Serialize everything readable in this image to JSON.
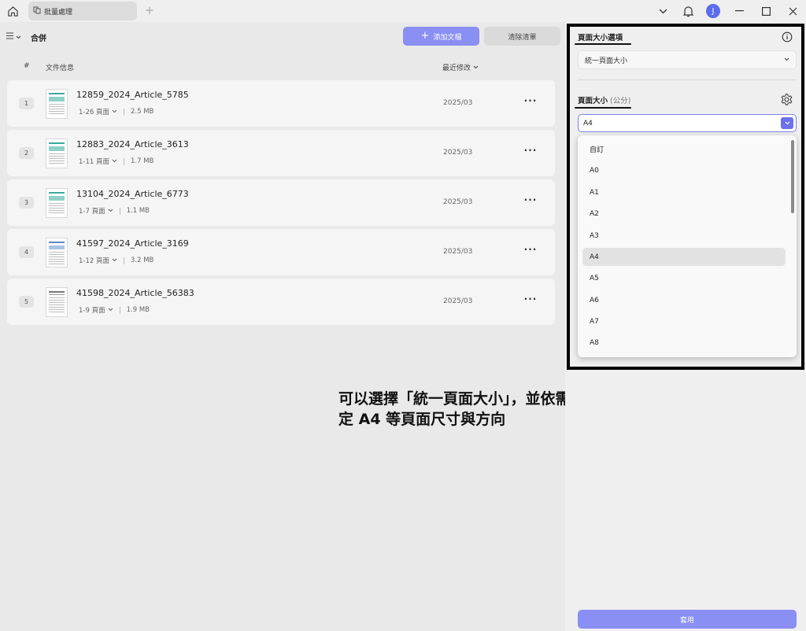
{
  "titlebar": {
    "tab_label": "批量處理",
    "avatar_letter": "J"
  },
  "toolbar": {
    "title": "合併",
    "add_label": "添加文檔",
    "clear_label": "清除清單"
  },
  "table": {
    "col_number": "#",
    "col_info": "文件信息",
    "col_modified": "最近修改"
  },
  "files": [
    {
      "number": "1",
      "name": "12859_2024_Article_5785",
      "pages": "1-26 頁面",
      "size": "2.5 MB",
      "date": "2025/03"
    },
    {
      "number": "2",
      "name": "12883_2024_Article_3613",
      "pages": "1-11 頁面",
      "size": "1.7 MB",
      "date": "2025/03"
    },
    {
      "number": "3",
      "name": "13104_2024_Article_6773",
      "pages": "1-7 頁面",
      "size": "1.1 MB",
      "date": "2025/03"
    },
    {
      "number": "4",
      "name": "41597_2024_Article_3169",
      "pages": "1-12 頁面",
      "size": "3.2 MB",
      "date": "2025/03"
    },
    {
      "number": "5",
      "name": "41598_2024_Article_56383",
      "pages": "1-9 頁面",
      "size": "1.9 MB",
      "date": "2025/03"
    }
  ],
  "panel": {
    "page_size_options_title": "頁面大小選項",
    "page_size_mode": "統一頁面大小",
    "page_size_title": "頁面大小",
    "page_size_unit": "(公分)",
    "page_size_value": "A4",
    "dropdown_options": [
      "自訂",
      "A0",
      "A1",
      "A2",
      "A3",
      "A4",
      "A5",
      "A6",
      "A7",
      "A8"
    ],
    "selected_option": "A4",
    "apply_label": "套用"
  },
  "caption": {
    "line1": "可以選擇「統一頁面大小」，並依需求設",
    "line2": "定 A4 等頁面尺寸與方向"
  },
  "colors": {
    "accent": "#8a8ff3",
    "accent_dark": "#6b71ec",
    "highlight_border": "#000000"
  }
}
